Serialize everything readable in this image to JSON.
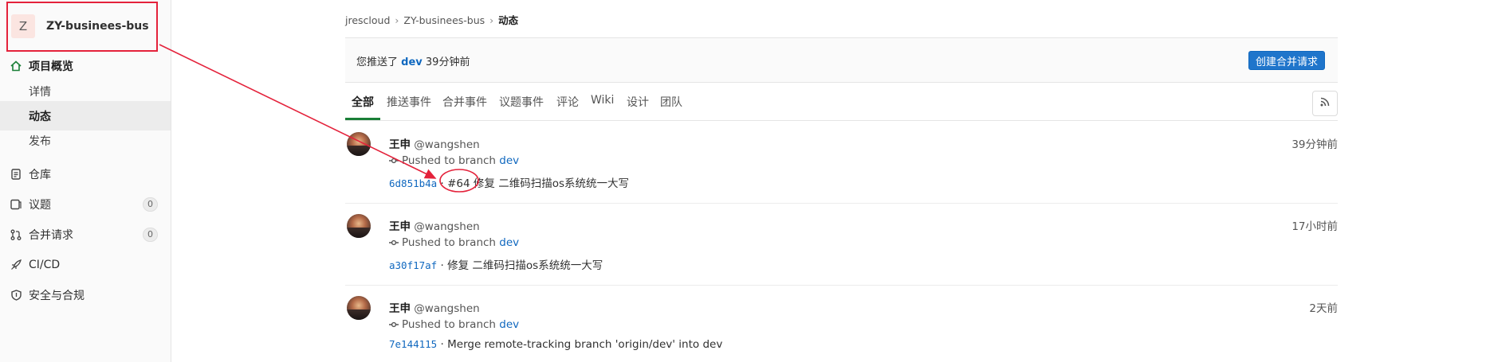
{
  "sidebar": {
    "project_initial": "Z",
    "project_name": "ZY-businees-bus",
    "overview_label": "项目概览",
    "sub_items": [
      "详情",
      "动态",
      "发布"
    ],
    "items": [
      {
        "label": "仓库",
        "icon": "document-icon"
      },
      {
        "label": "议题",
        "icon": "issues-icon",
        "count": "0"
      },
      {
        "label": "合并请求",
        "icon": "merge-request-icon",
        "count": "0"
      },
      {
        "label": "CI/CD",
        "icon": "rocket-icon"
      },
      {
        "label": "安全与合规",
        "icon": "shield-icon"
      }
    ]
  },
  "breadcrumb": [
    "jrescloud",
    "ZY-businees-bus",
    "动态"
  ],
  "notice": {
    "prefix": "您推送了",
    "branch": "dev",
    "suffix": "39分钟前",
    "button_label": "创建合并请求"
  },
  "tabs": [
    "全部",
    "推送事件",
    "合并事件",
    "议题事件",
    "评论",
    "Wiki",
    "设计",
    "团队"
  ],
  "events": [
    {
      "author": "王申",
      "handle": "@wangshen",
      "time": "39分钟前",
      "action": "Pushed to branch",
      "branch": "dev",
      "sha": "6d851b4a",
      "sep": "·",
      "ref": "#64",
      "message": "修复 二维码扫描os系统统一大写"
    },
    {
      "author": "王申",
      "handle": "@wangshen",
      "time": "17小时前",
      "action": "Pushed to branch",
      "branch": "dev",
      "sha": "a30f17af",
      "sep": "·",
      "message": "修复 二维码扫描os系统统一大写"
    },
    {
      "author": "王申",
      "handle": "@wangshen",
      "time": "2天前",
      "action": "Pushed to branch",
      "branch": "dev",
      "sha": "7e144115",
      "sep": "·",
      "message": "Merge remote-tracking branch 'origin/dev' into dev"
    }
  ],
  "colors": {
    "accent": "#1a7f37",
    "link": "#1068bf",
    "primary_button": "#1f75cb",
    "annotation": "#e4223b"
  }
}
